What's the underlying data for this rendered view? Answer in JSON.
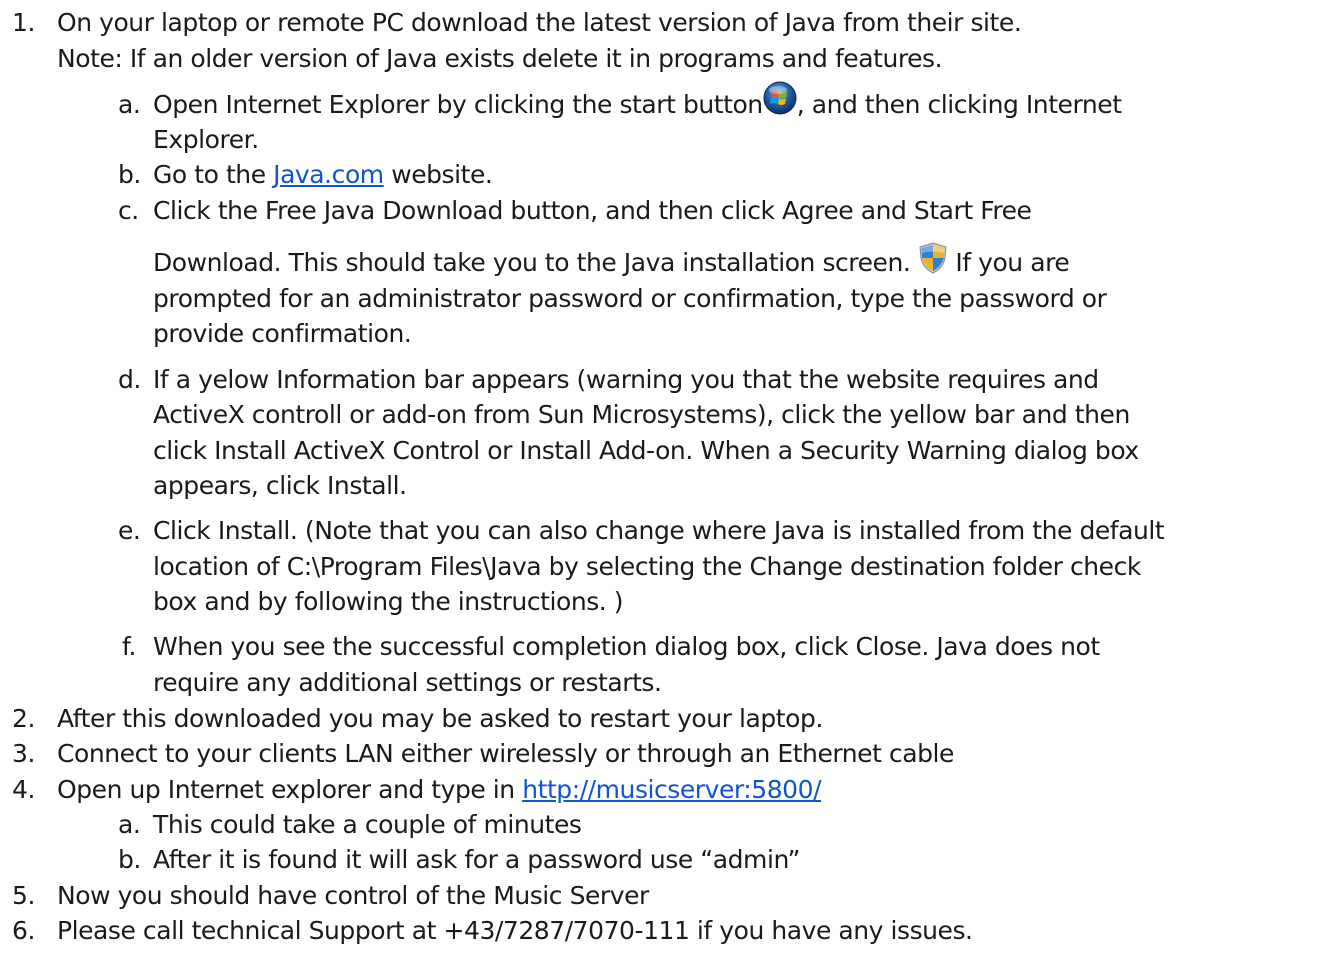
{
  "items": [
    {
      "num": "1.",
      "line1": "On your laptop or remote PC download the latest version of Java from their site.",
      "line2": "Note: If an older version of Java exists delete it in programs and features."
    },
    {
      "num": "2.",
      "text": "After this downloaded you may be asked to restart your laptop."
    },
    {
      "num": "3.",
      "text": "Connect to your clients LAN either wirelessly or through an Ethernet cable"
    },
    {
      "num": "4.",
      "text_before": "Open up Internet explorer and type in ",
      "link": "http://musicserver:5800/"
    },
    {
      "num": "5.",
      "text": "Now you should have control of the Music Server"
    },
    {
      "num": "6.",
      "text": "Please call technical Support at +43/7287/7070-111 if you have any issues."
    }
  ],
  "sub1": {
    "a": {
      "num": "a.",
      "line1_before": "Open Internet Explorer by clicking the start button",
      "line1_after": ", and then clicking Internet",
      "line2": "Explorer.",
      "icon": "windows-start-orb-icon"
    },
    "b": {
      "num": "b.",
      "before": "Go to the ",
      "link": "Java.com",
      "after": " website."
    },
    "c": {
      "num": "c.",
      "line1": "Click the Free Java Download button, and then click Agree and Start Free",
      "line2_before": "Download. This should take you to the Java installation screen. ",
      "line2_after": " If you are",
      "line3": "prompted for an administrator password or confirmation, type the password or",
      "line4": "provide confirmation.",
      "icon": "uac-shield-icon"
    },
    "d": {
      "num": "d.",
      "line1": "If a yelow Information bar appears (warning you that the website requires and",
      "line2": "ActiveX controll or add-on from Sun Microsystems), click the yellow bar and then",
      "line3": "click Install ActiveX Control or Install Add-on. When a Security Warning dialog box",
      "line4": "appears, click Install."
    },
    "e": {
      "num": "e.",
      "line1": "Click Install. (Note that you can also change where Java is installed from the default",
      "line2": "location of C:\\Program Files\\Java by selecting the Change destination folder check",
      "line3": "box and by following the instructions. )"
    },
    "f": {
      "num": "f.",
      "line1": "When you see the successful completion dialog box, click Close. Java does not",
      "line2": "require any additional settings or restarts."
    }
  },
  "sub4": {
    "a": {
      "num": "a.",
      "text": "This could take a couple of minutes"
    },
    "b": {
      "num": "b.",
      "text": "After it is found it will ask for a password use “admin”"
    }
  },
  "colors": {
    "text": "#1a1a1a",
    "link": "#1155cc"
  }
}
